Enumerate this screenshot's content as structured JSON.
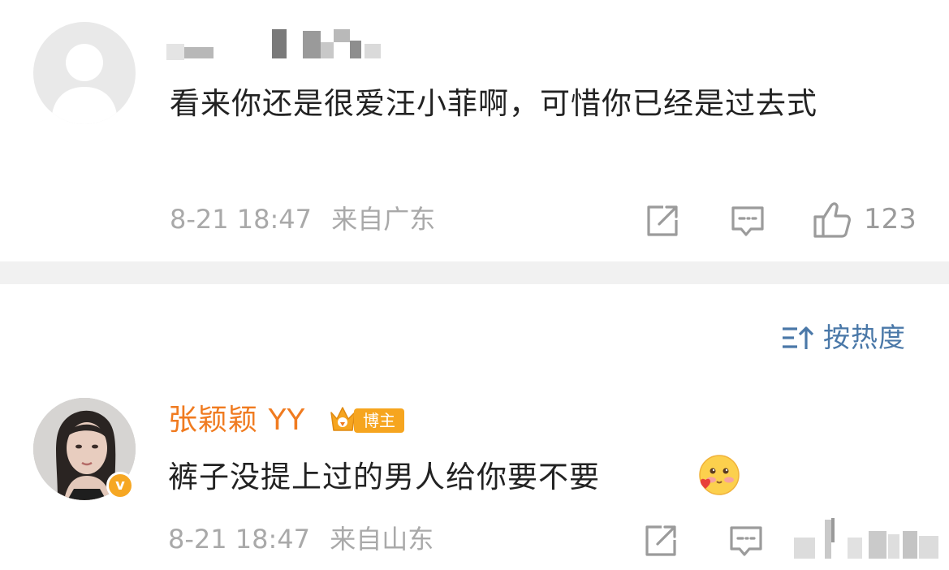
{
  "comments": [
    {
      "text": "看来你还是很爱汪小菲啊，可惜你已经是过去式",
      "time": "8-21 18:47",
      "location": "来自广东",
      "like_count": "123",
      "icons": [
        "share-icon",
        "comment-icon",
        "thumbs-up-icon"
      ]
    },
    {
      "author": "张颖颖 YY",
      "badge": "博主",
      "verified_mark": "v",
      "text": "裤子没提上过的男人给你要不要",
      "emoji": "blushing-heart-emoji",
      "time": "8-21 18:47",
      "location": "来自山东",
      "icons": [
        "share-icon",
        "comment-icon"
      ]
    }
  ],
  "sort": {
    "label": "按热度",
    "icon": "sort-icon"
  },
  "colors": {
    "author_name": "#f07b20",
    "badge_bg": "#f6a51f",
    "sort_accent": "#4a78a8",
    "meta_text": "#a9a9a9",
    "divider": "#f1f1f1"
  }
}
